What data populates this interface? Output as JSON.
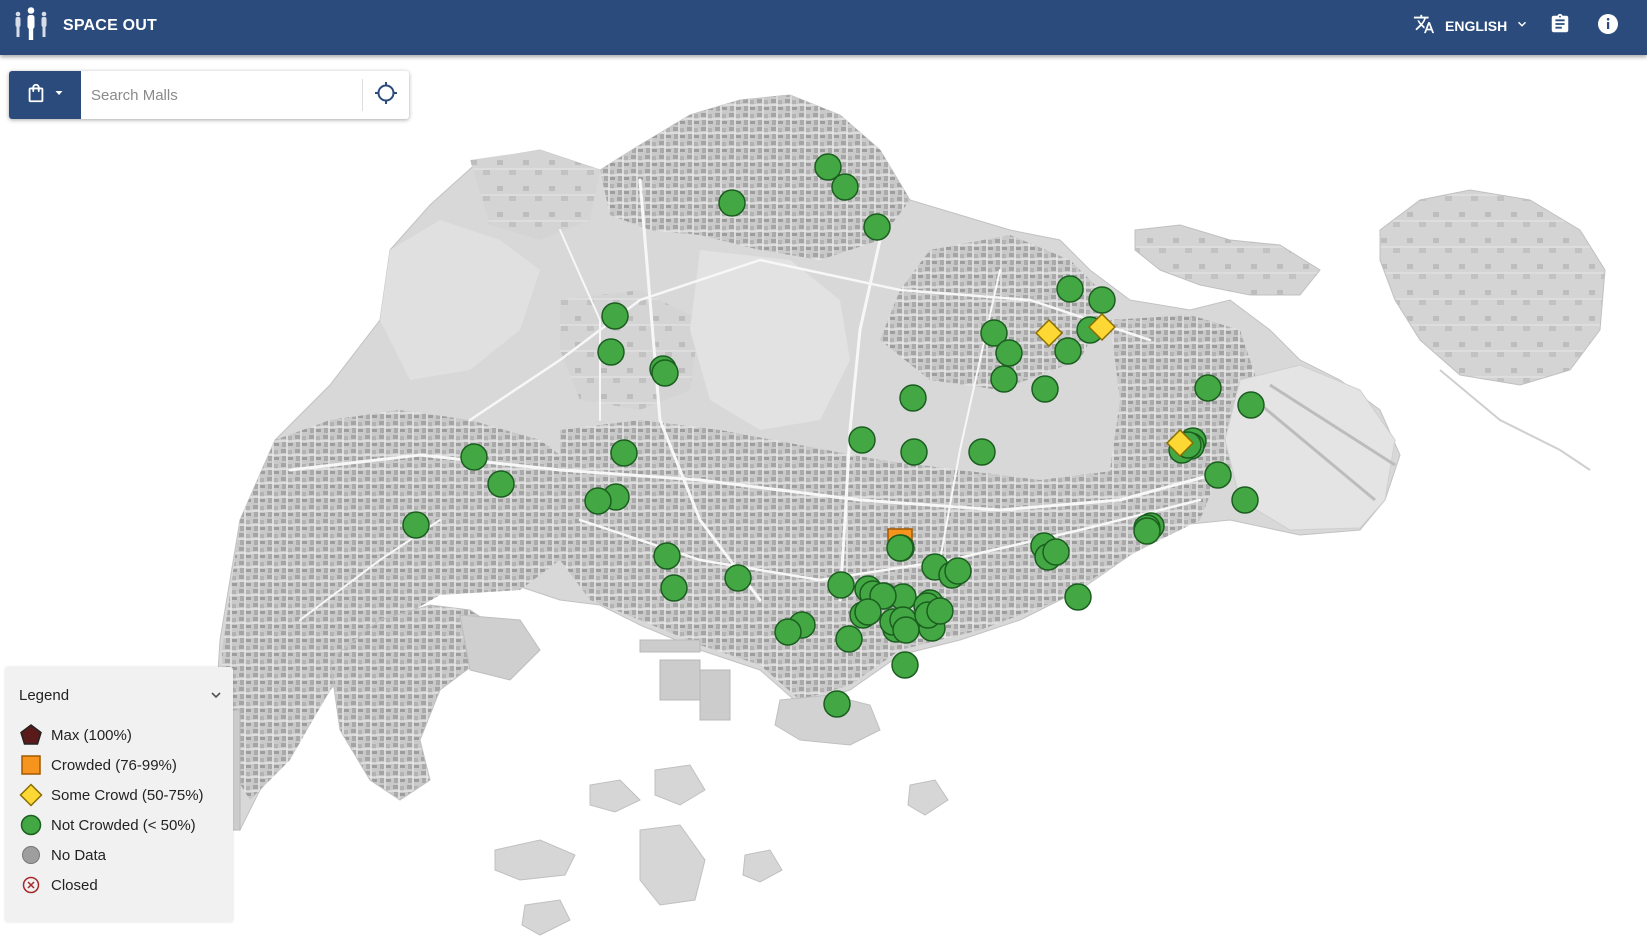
{
  "app": {
    "title": "SPACE OUT"
  },
  "header": {
    "language_label": "ENGLISH"
  },
  "search": {
    "placeholder": "Search Malls"
  },
  "colors": {
    "brand": "#2a4b7c",
    "max": "#5a1a1a",
    "crowded": "#f7941d",
    "some_crowd": "#fdd835",
    "not_crowded": "#43a843",
    "no_data": "#9e9e9e",
    "closed": "#a52a2a",
    "land": "#d9d9d9",
    "sea": "#ffffff"
  },
  "icons": {
    "logo": "people-icon",
    "language": "translate-icon",
    "dropdown": "chevron-down-icon",
    "report": "clipboard-icon",
    "info": "info-icon",
    "category": "shopping-bag-icon",
    "locate": "crosshair-icon"
  },
  "legend": {
    "title": "Legend",
    "items": [
      {
        "label": "Max (100%)",
        "symbol": "pentagon",
        "color": "#5a1a1a"
      },
      {
        "label": "Crowded (76-99%)",
        "symbol": "square",
        "color": "#f7941d"
      },
      {
        "label": "Some Crowd (50-75%)",
        "symbol": "diamond",
        "color": "#fdd835"
      },
      {
        "label": "Not Crowded (< 50%)",
        "symbol": "circle",
        "color": "#43a843"
      },
      {
        "label": "No Data",
        "symbol": "grey-circle",
        "color": "#9e9e9e"
      },
      {
        "label": "Closed",
        "symbol": "x-circle",
        "color": "#a52a2a"
      }
    ]
  },
  "markers": {
    "not_crowded": 70,
    "some_crowd": 3,
    "crowded": 1,
    "max": 0
  }
}
